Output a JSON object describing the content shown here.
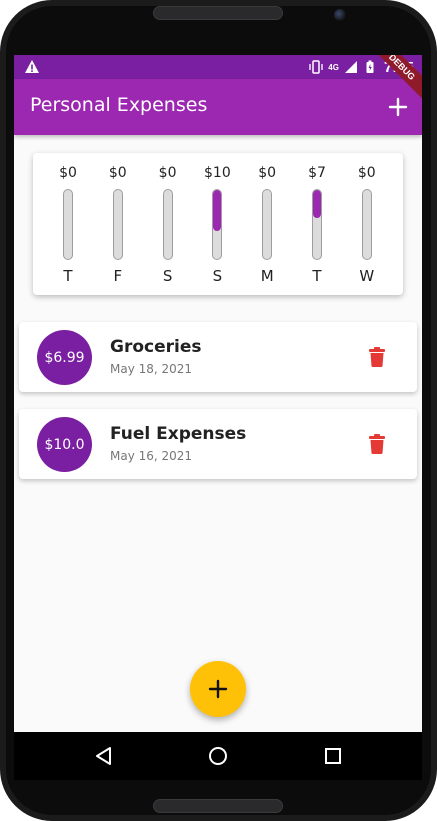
{
  "status_bar": {
    "time": "7:05",
    "network": "4G",
    "icons": [
      "alert-icon",
      "vibrate-icon",
      "signal-icon",
      "battery-icon"
    ]
  },
  "debug_banner": "DEBUG",
  "app_bar": {
    "title": "Personal Expenses",
    "add_icon": "plus-icon"
  },
  "chart_data": {
    "type": "bar",
    "categories": [
      "T",
      "F",
      "S",
      "S",
      "M",
      "T",
      "W"
    ],
    "values": [
      0,
      0,
      0,
      10,
      0,
      7,
      0
    ],
    "labels": [
      "$0",
      "$0",
      "$0",
      "$10",
      "$0",
      "$7",
      "$0"
    ],
    "fractions": [
      0,
      0,
      0,
      0.59,
      0,
      0.41,
      0
    ],
    "fill_color": "#9c27b0"
  },
  "transactions": [
    {
      "amount": "$6.99",
      "title": "Groceries",
      "date": "May 18, 2021"
    },
    {
      "amount": "$10.0",
      "title": "Fuel Expenses",
      "date": "May 16, 2021"
    }
  ],
  "colors": {
    "primary": "#9c27b0",
    "primary_dark": "#7b1fa2",
    "accent": "#ffc107",
    "delete": "#e53935"
  },
  "fab_icon": "plus-icon",
  "nav": [
    "back-icon",
    "home-icon",
    "recents-icon"
  ]
}
